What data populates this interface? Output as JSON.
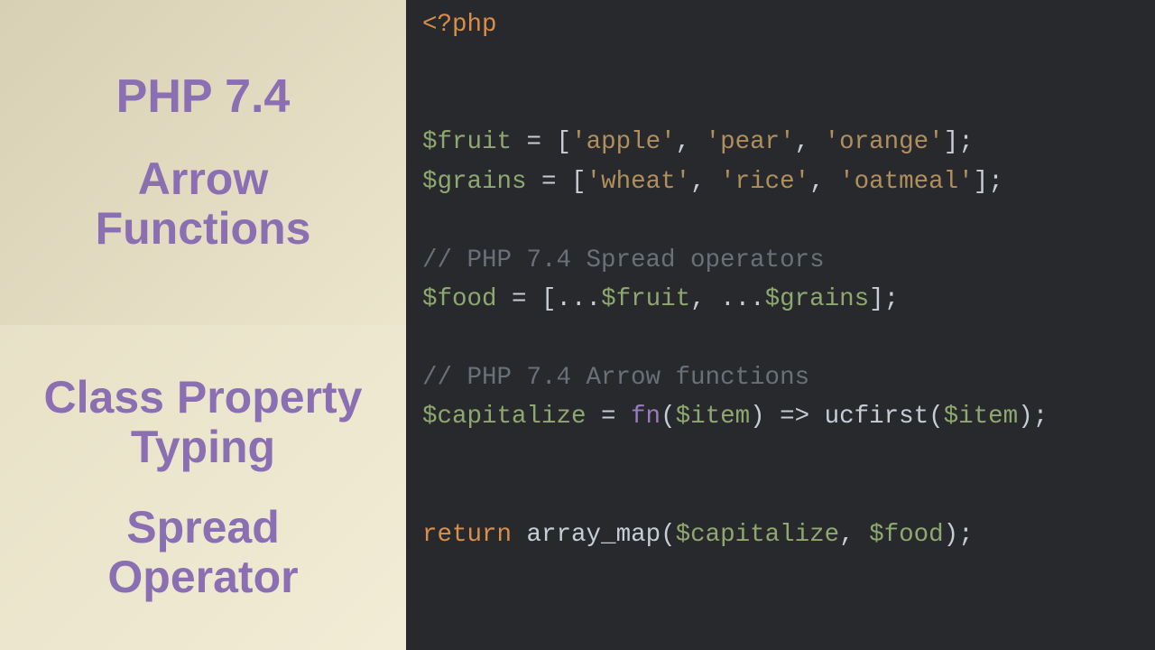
{
  "sidebar": {
    "top": {
      "title": "PHP 7.4",
      "subtitle": "Arrow\nFunctions"
    },
    "bottom": {
      "title": "Class Property\nTyping",
      "subtitle": "Spread\nOperator"
    }
  },
  "code": {
    "open_tag": "<?php",
    "var_fruit": "$fruit",
    "var_grains": "$grains",
    "var_food": "$food",
    "var_capitalize": "$capitalize",
    "var_item": "$item",
    "eq": " = ",
    "lbracket": "[",
    "rbracket": "]",
    "lparen": "(",
    "rparen": ")",
    "comma": ", ",
    "semi": ";",
    "spread": "...",
    "arrow": " => ",
    "kw_fn": "fn",
    "kw_return": "return",
    "fn_ucfirst": "ucfirst",
    "fn_array_map": "array_map",
    "str_apple": "'apple'",
    "str_pear": "'pear'",
    "str_orange": "'orange'",
    "str_wheat": "'wheat'",
    "str_rice": "'rice'",
    "str_oatmeal": "'oatmeal'",
    "comment_spread": "// PHP 7.4 Spread operators",
    "comment_arrow": "// PHP 7.4 Arrow functions"
  }
}
